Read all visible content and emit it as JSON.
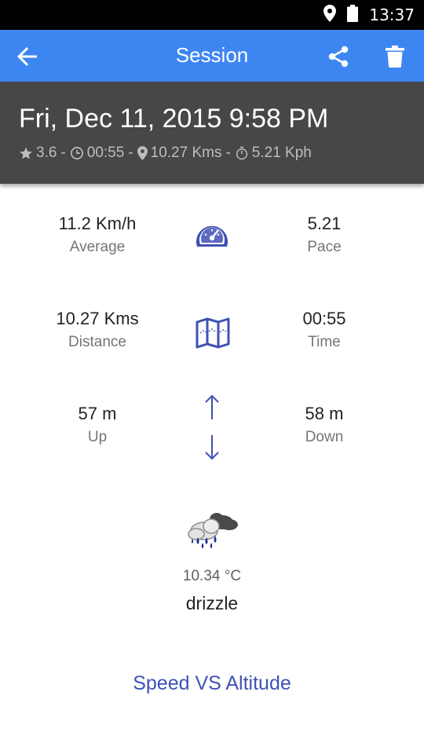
{
  "status_bar": {
    "time": "13:37",
    "icons": [
      "location-icon",
      "battery-icon"
    ]
  },
  "app_bar": {
    "title": "Session",
    "actions": [
      "back-arrow-icon",
      "share-icon",
      "trash-icon"
    ]
  },
  "session_header": {
    "date": "Fri, Dec 11, 2015 9:58 PM",
    "rating": "3.6",
    "duration": "00:55",
    "distance": "10.27 Kms",
    "speed": "5.21 Kph",
    "separator": "-"
  },
  "stats": {
    "average": {
      "value": "11.2 Km/h",
      "label": "Average"
    },
    "pace": {
      "value": "5.21",
      "label": "Pace"
    },
    "distance": {
      "value": "10.27 Kms",
      "label": "Distance"
    },
    "time": {
      "value": "00:55",
      "label": "Time"
    },
    "up": {
      "value": "57 m",
      "label": "Up"
    },
    "down": {
      "value": "58 m",
      "label": "Down"
    }
  },
  "weather": {
    "icon": "drizzle-weather-icon",
    "temperature": "10.34 °C",
    "condition": "drizzle"
  },
  "chart_link": {
    "label": "Speed VS Altitude"
  },
  "colors": {
    "app_bar": "#3d86f2",
    "header_card": "#474747",
    "accent_icon": "#3f51b5",
    "link": "#3f51b5"
  }
}
